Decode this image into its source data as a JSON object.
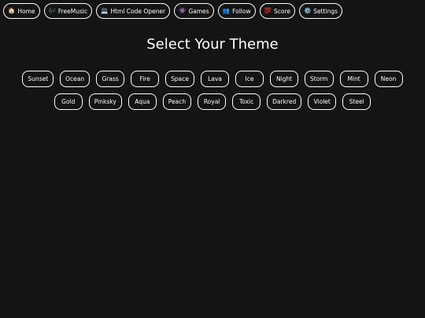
{
  "nav": {
    "items": [
      {
        "icon": "🏠",
        "label": "Home",
        "icon_name": "home-icon"
      },
      {
        "icon": "🎶",
        "label": "FreeMusic",
        "icon_name": "music-icon"
      },
      {
        "icon": "💻",
        "label": "Html Code Opener",
        "icon_name": "laptop-icon"
      },
      {
        "icon": "👾",
        "label": "Games",
        "icon_name": "game-icon"
      },
      {
        "icon": "👥",
        "label": "Follow",
        "icon_name": "users-icon"
      },
      {
        "icon": "💯",
        "label": "Score",
        "icon_name": "hundred-icon"
      },
      {
        "icon": "⚙️",
        "label": "Settings",
        "icon_name": "gear-icon"
      }
    ]
  },
  "main": {
    "title": "Select Your Theme",
    "themes": [
      "Sunset",
      "Ocean",
      "Grass",
      "Fire",
      "Space",
      "Lava",
      "Ice",
      "Night",
      "Storm",
      "Mint",
      "Neon",
      "Gold",
      "Pinksky",
      "Aqua",
      "Peach",
      "Royal",
      "Toxic",
      "Darkred",
      "Violet",
      "Steel"
    ]
  },
  "colors": {
    "background": "#141414",
    "text": "#ffffff",
    "border": "#ffffff"
  }
}
